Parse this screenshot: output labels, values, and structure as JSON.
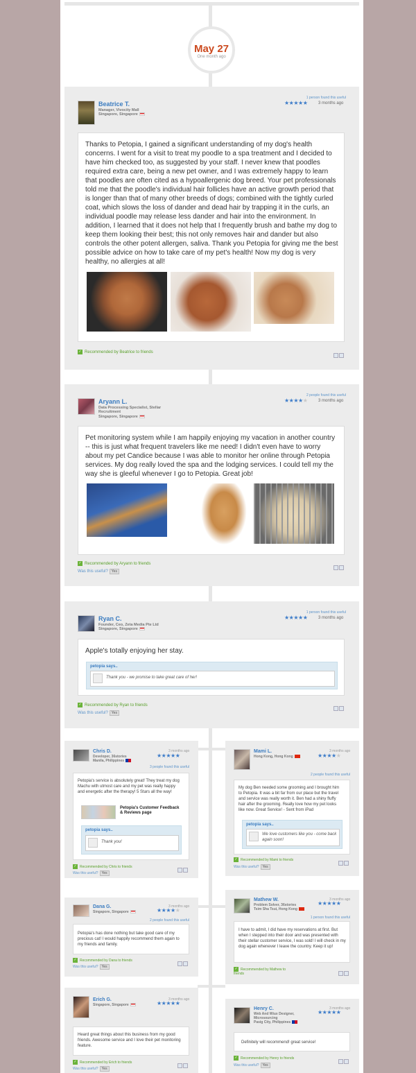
{
  "date": {
    "day": "May 27",
    "ago": "One month ago"
  },
  "reviews": [
    {
      "name": "Beatrice T.",
      "title": "Manager, Vivocity Mall",
      "location": "Singapore, Singapore",
      "useful_count": "1 person found this useful",
      "rating": 5,
      "ago": "3 months ago",
      "text": "Thanks to Petopia, I gained a significant understanding of my dog's health concerns. I went for a visit to treat my poodle to a spa treatment and I decided to have him checked too, as suggested by your staff. I never knew that poodles required extra care, being a new pet owner, and I was extremely happy to learn that poodles are often cited as a hypoallergenic dog breed. Your pet professionals told me that the poodle's individual hair follicles have an active growth period that is longer than that of many other breeds of dogs; combined with the tightly curled coat, which slows the loss of dander and dead hair by trapping it in the curls, an individual poodle may release less dander and hair into the environment. In addition, I learned that it does not help that I frequently brush and bathe my dog to keep them looking their best; this not only removes hair and dander but also controls the other potent allergen, saliva. Thank you Petopia for giving me the best possible advice on how to take care of my pet's health! Now my dog is very healthy, no allergies at all!",
      "recommended": "Recommended by Beatrice to friends"
    },
    {
      "name": "Aryann L.",
      "title": "Data Processing Specialist, Stellar Recruitment",
      "location": "Singapore, Singapore",
      "useful_count": "2 people found this useful",
      "rating": 4,
      "ago": "3 months ago",
      "text": "Pet monitoring system while I am happily enjoying my vacation in another country -- this is just what frequent travelers like me need! I didn't even have to worry about my pet Candice because I was able to monitor her online through Petopia services. My dog really loved the spa and the lodging services. I could tell my the way she is gleeful whenever I go to Petopia. Great job!",
      "recommended": "Recommended by Aryann to friends",
      "was_useful": "Was this useful?",
      "yes": "Yes"
    },
    {
      "name": "Ryan C.",
      "title": "Founder, Ceo, Zeta Media Pte Ltd",
      "location": "Singapore, Singapore",
      "useful_count": "1 person found this useful",
      "rating": 5,
      "ago": "3 months ago",
      "text": "Apple's totally enjoying her stay.",
      "petopia_label": "petopia says..",
      "petopia_reply": "Thank you - we promise to take great care of her!",
      "recommended": "Recommended by Ryan to friends",
      "was_useful": "Was this useful?",
      "yes": "Yes"
    }
  ],
  "small_reviews": [
    {
      "name": "Chris D.",
      "title": "Developer, 3 6stories",
      "title_text": "Developer, 36stories",
      "location": "Manila, Philippines",
      "ago": "3 months ago",
      "rating": 5,
      "useful_count": "3 people found this useful",
      "text": "Petopia's service is absolutely great! They treat my dog Machu with utmost care and my pet was really happy and energetic after the therapy! 5 Stars all the way!",
      "link_title": "Petopia's Customer Feedback & Reviews page",
      "petopia_label": "petopia says..",
      "petopia_reply": "Thank you!",
      "recommended": "Recommended by Chris to friends",
      "was_useful": "Was this useful?",
      "yes": "Yes"
    },
    {
      "name": "Mami L.",
      "location": "Hong Kong, Hong Kong",
      "ago": "3 months ago",
      "rating": 4,
      "useful_count": "2 people found this useful",
      "text": "My dog Ben needed some grooming and I brought him to Petopia. It was a bit far from our place but the travel and service was really worth it. Ben had a shiny fluffy hair after the grooming. Really love how my pet looks like now. Great Service! - Sent from iPad",
      "petopia_label": "petopia says..",
      "petopia_reply": "We love customers like you - come back again soon!",
      "recommended": "Recommended by Mami to friends",
      "was_useful": "Was this useful?",
      "yes": "Yes"
    },
    {
      "name": "Dana G.",
      "location": "Singapore, Singapore",
      "ago": "3 months ago",
      "rating": 4,
      "useful_count": "2 people found this useful",
      "text": "Petopia's has done nothing but take good care of my precious cat! I would happily recommend them again to my friends and family.",
      "recommended": "Recommended by Dana to friends",
      "was_useful": "Was this useful?",
      "yes": "Yes"
    },
    {
      "name": "Mathew W.",
      "title": "Problem Solver, 36stories",
      "location": "Tsim Sha Tsui, Hong Kong",
      "ago": "3 months ago",
      "rating": 5,
      "useful_count": "1 person found this useful",
      "text": "I have to admit, I did have my reservations at first. But when I stepped into their door and was presented with their stellar customer service, I was sold! I will check in my dog again whenever I leave the country. Keep it up!",
      "recommended": "Recommended by Mathew to friends"
    },
    {
      "name": "Erich G.",
      "location": "Singapore, Singapore",
      "ago": "3 months ago",
      "rating": 5,
      "text": "Heard great things about this business from my good friends. Awesome service and I love their pet monitoring feature.",
      "recommended": "Recommended by Erich to friends",
      "was_useful": "Was this useful?",
      "yes": "Yes"
    },
    {
      "name": "Henry C.",
      "title": "Web And Wiux Designer, Microsourcing",
      "location": "Pasig City, Philippines",
      "ago": "3 months ago",
      "rating": 5,
      "text": "Definitely will recommend! great service!",
      "recommended": "Recommended by Henry to friends",
      "was_useful": "Was this useful?",
      "yes": "Yes"
    }
  ],
  "colors": {
    "accent": "#3b7cc0",
    "date": "#cc4a1f",
    "recommend": "#5aa02c",
    "background": "#b8a6a6"
  }
}
